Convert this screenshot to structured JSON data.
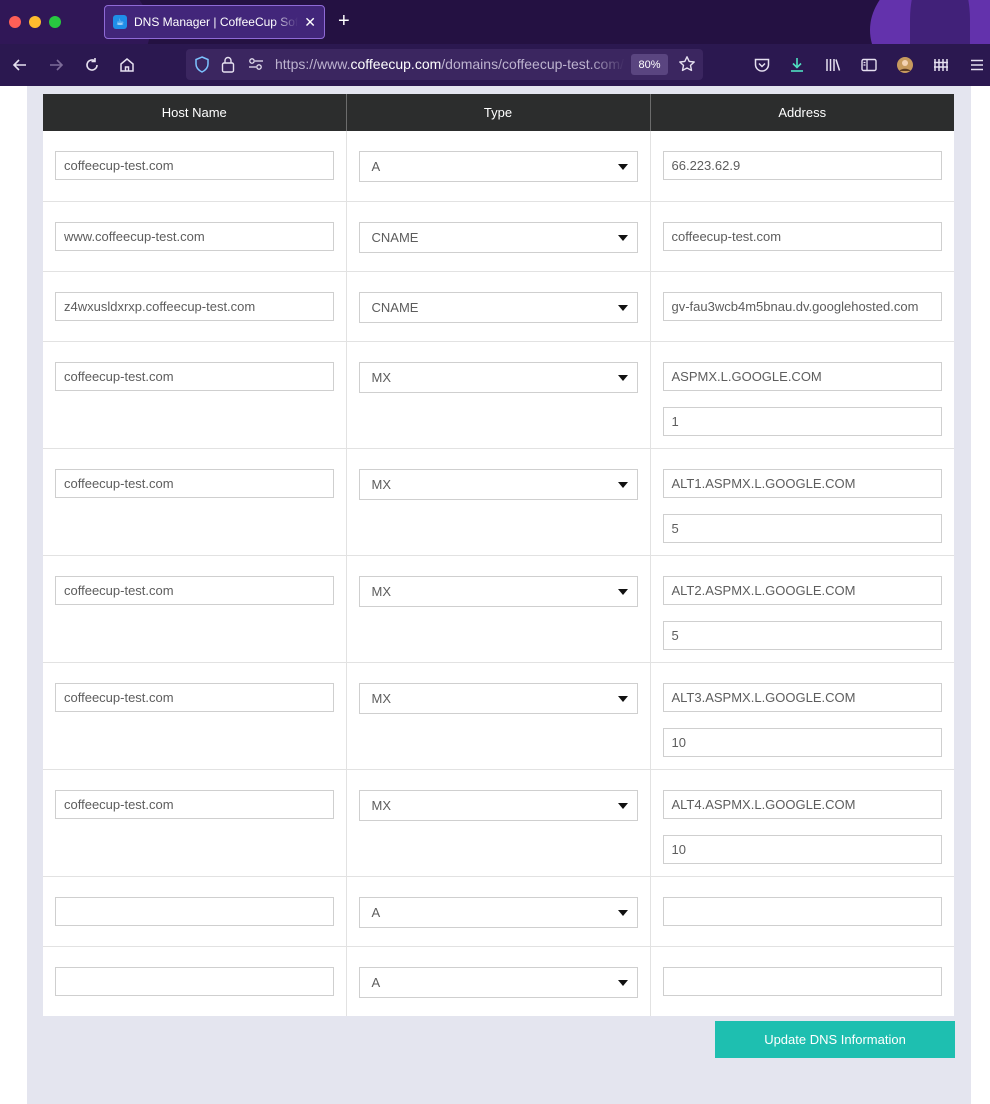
{
  "browser": {
    "tab_title": "DNS Manager | CoffeeCup Software",
    "new_tab_icon": "plus-icon",
    "url_prefix": "https://www.",
    "url_host": "coffeecup.com",
    "url_path": "/domains/coffeecup-test.com/dns",
    "zoom": "80%"
  },
  "table": {
    "headers": [
      "Host Name",
      "Type",
      "Address"
    ],
    "rows": [
      {
        "host": "coffeecup-test.com",
        "type": "A",
        "address": "66.223.62.9",
        "priority": null
      },
      {
        "host": "www.coffeecup-test.com",
        "type": "CNAME",
        "address": "coffeecup-test.com",
        "priority": null
      },
      {
        "host": "z4wxusldxrxp.coffeecup-test.com",
        "type": "CNAME",
        "address": "gv-fau3wcb4m5bnau.dv.googlehosted.com",
        "priority": null
      },
      {
        "host": "coffeecup-test.com",
        "type": "MX",
        "address": "ASPMX.L.GOOGLE.COM",
        "priority": "1"
      },
      {
        "host": "coffeecup-test.com",
        "type": "MX",
        "address": "ALT1.ASPMX.L.GOOGLE.COM",
        "priority": "5"
      },
      {
        "host": "coffeecup-test.com",
        "type": "MX",
        "address": "ALT2.ASPMX.L.GOOGLE.COM",
        "priority": "5"
      },
      {
        "host": "coffeecup-test.com",
        "type": "MX",
        "address": "ALT3.ASPMX.L.GOOGLE.COM",
        "priority": "10"
      },
      {
        "host": "coffeecup-test.com",
        "type": "MX",
        "address": "ALT4.ASPMX.L.GOOGLE.COM",
        "priority": "10"
      },
      {
        "host": "",
        "type": "A",
        "address": "",
        "priority": null
      },
      {
        "host": "",
        "type": "A",
        "address": "",
        "priority": null
      }
    ]
  },
  "actions": {
    "update_label": "Update DNS Information"
  },
  "colors": {
    "accent": "#1ebfb0",
    "header_bg": "#2c2d2d",
    "chrome_bg": "#241142"
  }
}
